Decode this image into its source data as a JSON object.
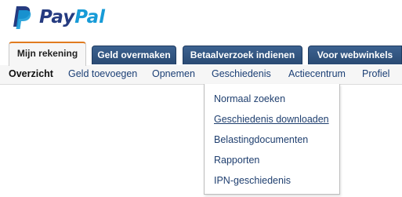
{
  "logo": {
    "text_pay": "Pay",
    "text_pal": "Pal"
  },
  "tabs": [
    {
      "label": "Mijn rekening",
      "active": true
    },
    {
      "label": "Geld overmaken",
      "active": false
    },
    {
      "label": "Betaalverzoek indienen",
      "active": false
    },
    {
      "label": "Voor webwinkels",
      "active": false
    }
  ],
  "subnav": [
    {
      "label": "Overzicht",
      "current": true
    },
    {
      "label": "Geld toevoegen",
      "current": false
    },
    {
      "label": "Opnemen",
      "current": false
    },
    {
      "label": "Geschiedenis",
      "current": false
    },
    {
      "label": "Actiecentrum",
      "current": false
    },
    {
      "label": "Profiel",
      "current": false
    }
  ],
  "history_menu": {
    "items": [
      {
        "label": "Normaal zoeken"
      },
      {
        "label": "Geschiedenis downloaden",
        "hovered": true
      },
      {
        "label": "Belastingdocumenten"
      },
      {
        "label": "Rapporten"
      },
      {
        "label": "IPN-geschiedenis"
      }
    ]
  },
  "colors": {
    "brand_dark": "#253b80",
    "brand_light": "#179bd7",
    "tab_blue": "#2a4a73",
    "active_tab_accent": "#e07b1f",
    "link": "#1b3f75"
  }
}
